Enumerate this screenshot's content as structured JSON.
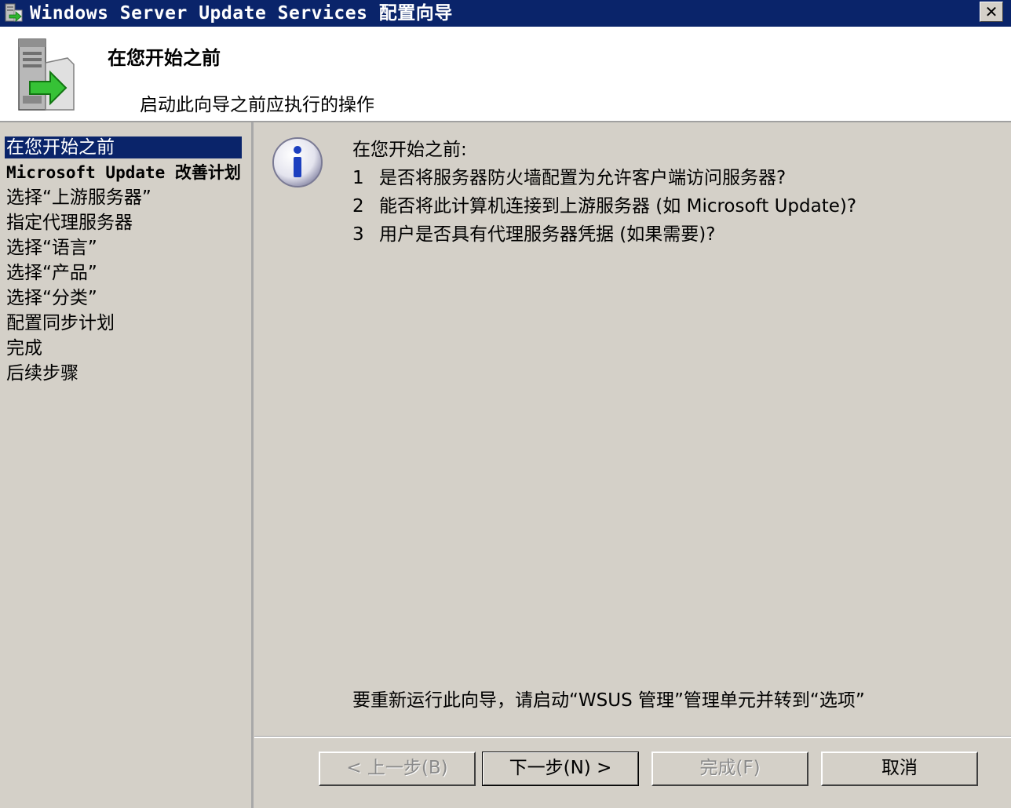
{
  "window": {
    "title": "Windows Server Update Services 配置向导",
    "close_label": "✕"
  },
  "header": {
    "title": "在您开始之前",
    "subtitle": "启动此向导之前应执行的操作"
  },
  "nav": {
    "items": [
      {
        "label": "在您开始之前",
        "active": true
      },
      {
        "label": "Microsoft Update 改善计划"
      },
      {
        "label": "选择“上游服务器”"
      },
      {
        "label": "指定代理服务器"
      },
      {
        "label": "选择“语言”"
      },
      {
        "label": "选择“产品”"
      },
      {
        "label": "选择“分类”"
      },
      {
        "label": "配置同步计划"
      },
      {
        "label": "完成"
      },
      {
        "label": "后续步骤"
      }
    ]
  },
  "content": {
    "intro": "在您开始之前:",
    "questions": [
      {
        "num": "1",
        "text": "是否将服务器防火墙配置为允许客户端访问服务器?"
      },
      {
        "num": "2",
        "text": "能否将此计算机连接到上游服务器 (如 Microsoft Update)?"
      },
      {
        "num": "3",
        "text": "用户是否具有代理服务器凭据 (如果需要)?"
      }
    ],
    "rerun_note": "要重新运行此向导，请启动“WSUS 管理”管理单元并转到“选项”"
  },
  "buttons": {
    "back": "< 上一步(B)",
    "next": "下一步(N) >",
    "finish": "完成(F)",
    "cancel": "取消"
  },
  "colors": {
    "titlebar": "#0a246a",
    "face": "#d4d0c8",
    "selection": "#0a246a"
  }
}
